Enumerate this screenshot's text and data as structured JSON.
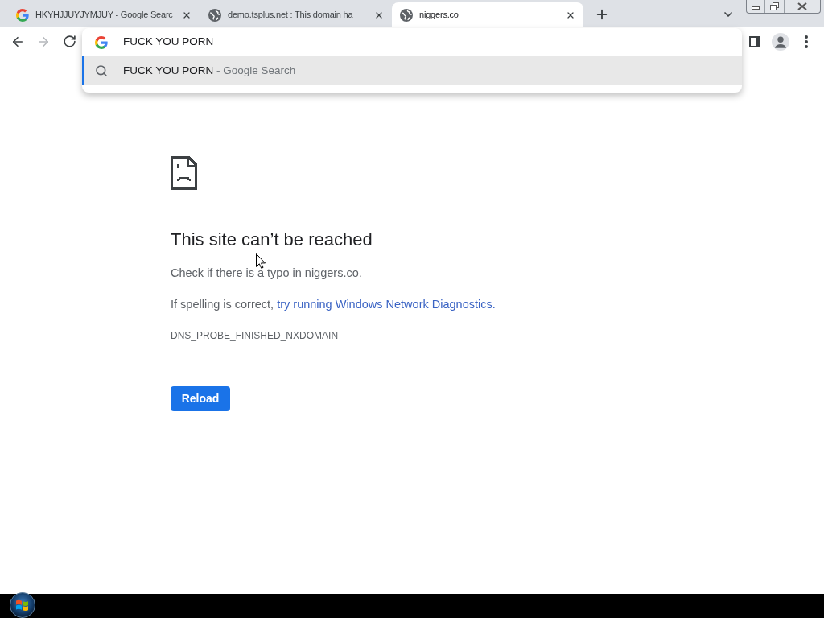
{
  "tabs": [
    {
      "title": "HKYHJJUYJYMJUY - Google Searc",
      "kind": "google",
      "selected": false
    },
    {
      "title": "demo.tsplus.net : This domain ha",
      "kind": "globe",
      "selected": false
    },
    {
      "title": "niggers.co",
      "kind": "globe",
      "selected": true
    }
  ],
  "toolbar": {
    "forward_disabled": true
  },
  "omnibox": {
    "value": "FUCK YOU PORN",
    "suggestions": [
      {
        "query": "FUCK YOU PORN",
        "source": "- Google Search",
        "selected": true
      }
    ]
  },
  "error_page": {
    "heading": "This site can’t be reached",
    "typo_hint": "Check if there is a typo in niggers.co.",
    "spelling_prefix": "If spelling is correct,",
    "diagnostics_link": "try running Windows Network Diagnostics.",
    "error_code": "DNS_PROBE_FINISHED_NXDOMAIN",
    "reload_button": "Reload"
  }
}
